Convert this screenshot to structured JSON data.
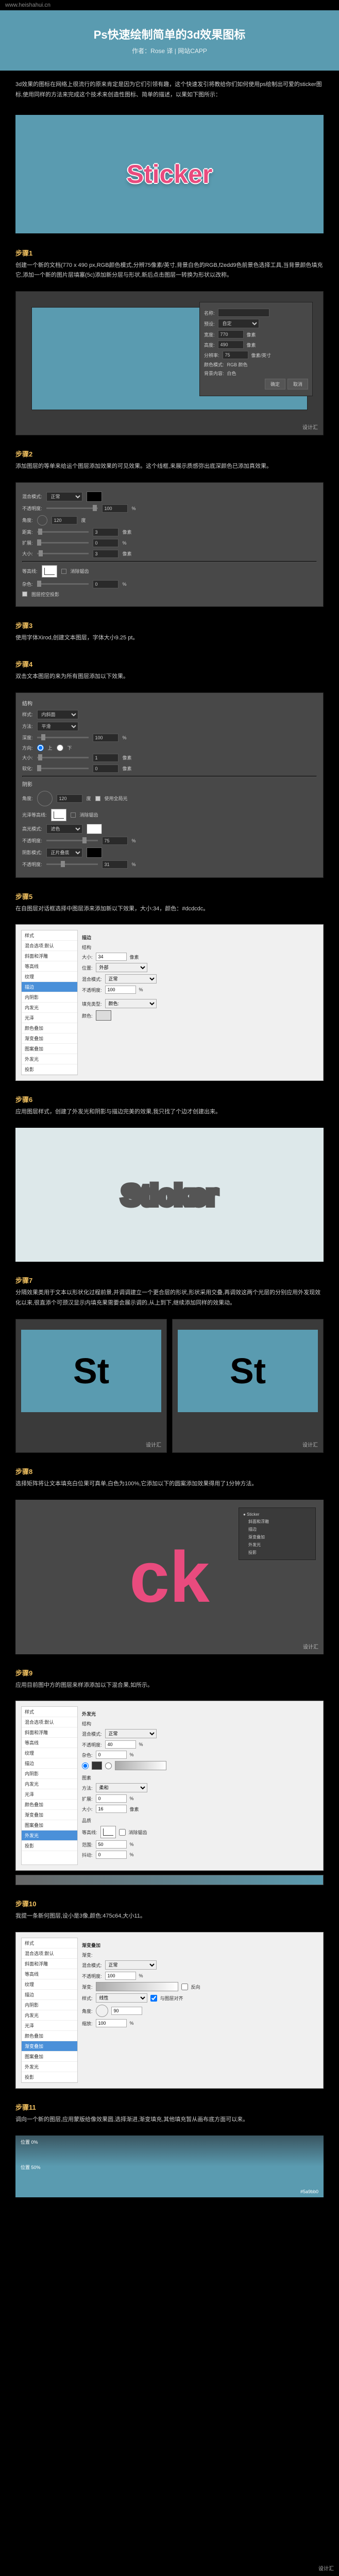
{
  "url": "www.heishahui.cn",
  "header": {
    "title": "Ps快速绘制简单的3d效果图标",
    "author": "作者：Rose 译 | 网站CAPP"
  },
  "intro": "3d效果的图标在网络上很流行的原来肯定是因为它们引领有趣，这个快速发引将教给你们如何使用ps绘制出可爱的sticker图标,使用同样的方法来完成这个技术来创造性图标、简单的描述，以果如下图所示：",
  "sticker": "Sticker",
  "steps": {
    "s1": {
      "label": "步骤1",
      "text": "创建一个新的文档(770 x 490 px,RGB颜色模式,分辨75像素/英寸,背景白色的RGB,f2edd9色前景色选择工具,当背景颜色填充它,添加一个新的图片层填塞(5c)添加新分层与形状,新后点击图层一转换为形状以改称。"
    },
    "s2": {
      "label": "步骤2",
      "text": "添加图层的等单来给运个图层添加效果的可见效果。这个线框,来展示质感弥出底深颜色已添加真效果。"
    },
    "s3": {
      "label": "步骤3",
      "text": "使用字体Xirod,创建文本图层，字体大小9.25 pt。"
    },
    "s4": {
      "label": "步骤4",
      "text": "双击文本图层的来为所有图层添加以下效果。"
    },
    "s5": {
      "label": "步骤5",
      "text": "在自图层对话框选择中图层添来添加新以下效果，大小:34，颜色：#dcdcdc。"
    },
    "s6": {
      "label": "步骤6",
      "text": "应用图层样式，创建了外发光和阴影与描边完美的效果,我只找了个边才创建出来。"
    },
    "s7": {
      "label": "步骤7",
      "text": "分隔效果类用于文本以形状化过程前景,并调调建立一个更合层的形状,形状采用交叠,再调效这两个光层的分别应用外发现效化以来,很直添个可颈汉显示内填充果需要会展示调的,从上到下,继续添加同样的效果动。"
    },
    "s8": {
      "label": "步骤8",
      "text": "选择矩阵将让文本填充白位果可真单,白色为100%,它添加以下的圆案添加效果得用了1分钟方法。"
    },
    "s9": {
      "label": "步骤9",
      "text": "应用目前图中方的图层来样添添加以下混合果,如所示。"
    },
    "s10": {
      "label": "步骤10",
      "text": "我提一条新何图层,设小是3像,颜色:475c64,大小11。"
    },
    "s11": {
      "label": "步骤11",
      "text": "调向一个新的图层,应用蒙版给像效果圆,选择渐进,渐变填充,其他填充暂从画布底方面可以来。"
    }
  },
  "panel": {
    "name": "名称:",
    "width": "宽度:",
    "height": "高度:",
    "res": "分辨率:",
    "mode": "颜色模式:",
    "bg": "背景内容:",
    "ok": "确定",
    "cancel": "取消",
    "preset": "预设:",
    "px": "像素",
    "ppi": "像素/英寸",
    "rgb": "RGB 颜色",
    "white": "白色",
    "custom": "自定"
  },
  "dialog2": {
    "blend": "混合模式:",
    "normal": "正常",
    "opacity": "不透明度:",
    "angle": "角度:",
    "dist": "距离:",
    "spread": "扩展:",
    "size": "大小:",
    "noise": "杂色:",
    "v100": "100",
    "v120": "120",
    "v0": "0",
    "v3": "3",
    "pct": "%",
    "deg": "度",
    "px": "像素"
  },
  "fx": {
    "styles": "样式",
    "blendopt": "混合选项:默认",
    "bevel": "斜面和浮雕",
    "contour": "等高线",
    "texture": "纹理",
    "stroke": "描边",
    "inner_shadow": "内阴影",
    "inner_glow": "内发光",
    "satin": "光泽",
    "color_overlay": "颜色叠加",
    "grad_overlay": "渐变叠加",
    "pattern": "图案叠加",
    "outer_glow": "外发光",
    "drop_shadow": "投影",
    "struct": "结构",
    "style_lbl": "样式:",
    "tech": "方法:",
    "depth": "深度:",
    "dir": "方向:",
    "up": "上",
    "down": "下",
    "soften": "软化:",
    "shading": "阴影",
    "gloss": "光泽等高线:",
    "highlight": "高光模式:",
    "shadow_mode": "阴影模式:",
    "screen": "滤色",
    "multiply": "正片叠底",
    "inner_bevel": "内斜面",
    "smooth": "平滑",
    "global": "使用全局光",
    "anti": "消除锯齿",
    "v1": "1",
    "v5": "5",
    "v31": "31",
    "v75": "75",
    "gradient": "渐变:",
    "reverse": "反向",
    "align": "与图层对齐",
    "scale": "缩放:",
    "linear": "线性",
    "fill_type": "填充类型:",
    "position": "位置:",
    "outside": "外部",
    "color": "颜色:",
    "elements": "图素",
    "quality": "品质",
    "range": "范围:",
    "jitter": "抖动:",
    "softer": "柔和",
    "v50": "50",
    "v34": "34",
    "v16": "16",
    "v40": "40",
    "contour_lbl": "等高线:",
    "knockout": "图层挖空投影"
  },
  "grad": {
    "top": "位置 0%",
    "mid": "位置 50%",
    "label": "#5a9bb0"
  }
}
